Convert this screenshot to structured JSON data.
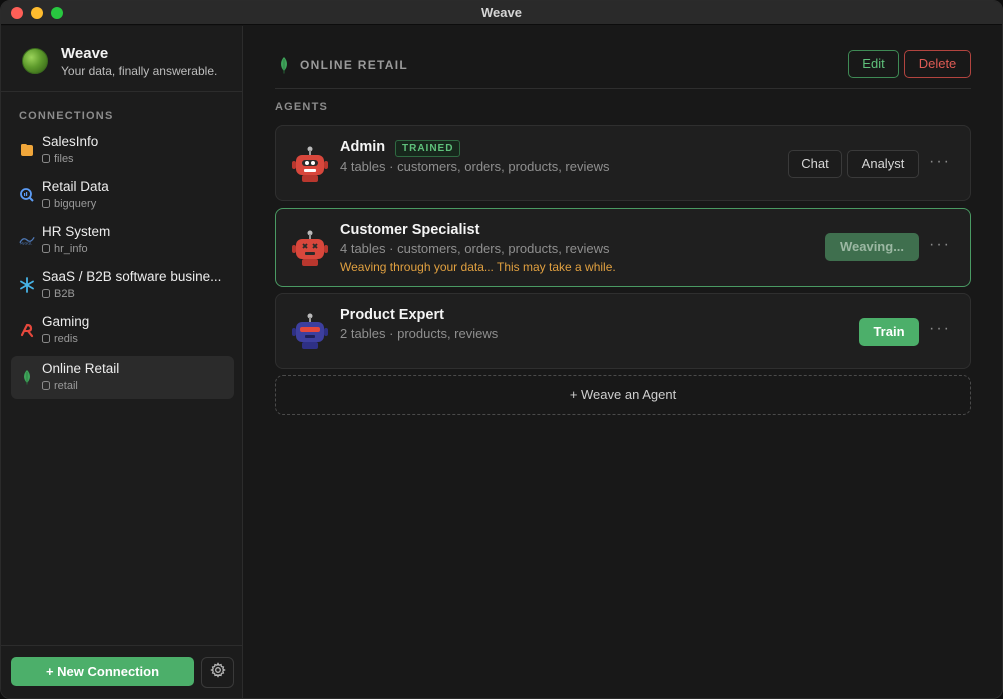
{
  "window": {
    "title": "Weave"
  },
  "brand": {
    "name": "Weave",
    "tagline": "Your data, finally answerable."
  },
  "sidebar": {
    "section_label": "CONNECTIONS",
    "items": [
      {
        "name": "SalesInfo",
        "sub": "files",
        "icon": "folder-icon",
        "active": false
      },
      {
        "name": "Retail Data",
        "sub": "bigquery",
        "icon": "bigquery-icon",
        "active": false
      },
      {
        "name": "HR System",
        "sub": "hr_info",
        "icon": "mysql-icon",
        "active": false
      },
      {
        "name": "SaaS / B2B software busine...",
        "sub": "B2B",
        "icon": "snowflake-icon",
        "active": false
      },
      {
        "name": "Gaming",
        "sub": "redis",
        "icon": "redis-icon",
        "active": false
      },
      {
        "name": "Online Retail",
        "sub": "retail",
        "icon": "mongodb-leaf-icon",
        "active": true
      }
    ],
    "new_connection_label": "+ New Connection"
  },
  "main": {
    "breadcrumb": "ONLINE RETAIL",
    "edit_label": "Edit",
    "delete_label": "Delete",
    "agents_label": "AGENTS",
    "agents": [
      {
        "name": "Admin",
        "badge": "TRAINED",
        "meta": "4 tables · customers, orders, products, reviews",
        "actions": [
          "Chat",
          "Analyst"
        ]
      },
      {
        "name": "Customer Specialist",
        "meta": "4 tables · customers, orders, products, reviews",
        "status": "Weaving through your data... This may take a while.",
        "action": "Weaving..."
      },
      {
        "name": "Product Expert",
        "meta": "2 tables · products, reviews",
        "action": "Train"
      }
    ],
    "more_label": "···",
    "add_agent_label": "+ Weave an Agent"
  },
  "colors": {
    "accent": "#4caf6a",
    "danger": "#df5b55",
    "warning": "#e0a040"
  }
}
